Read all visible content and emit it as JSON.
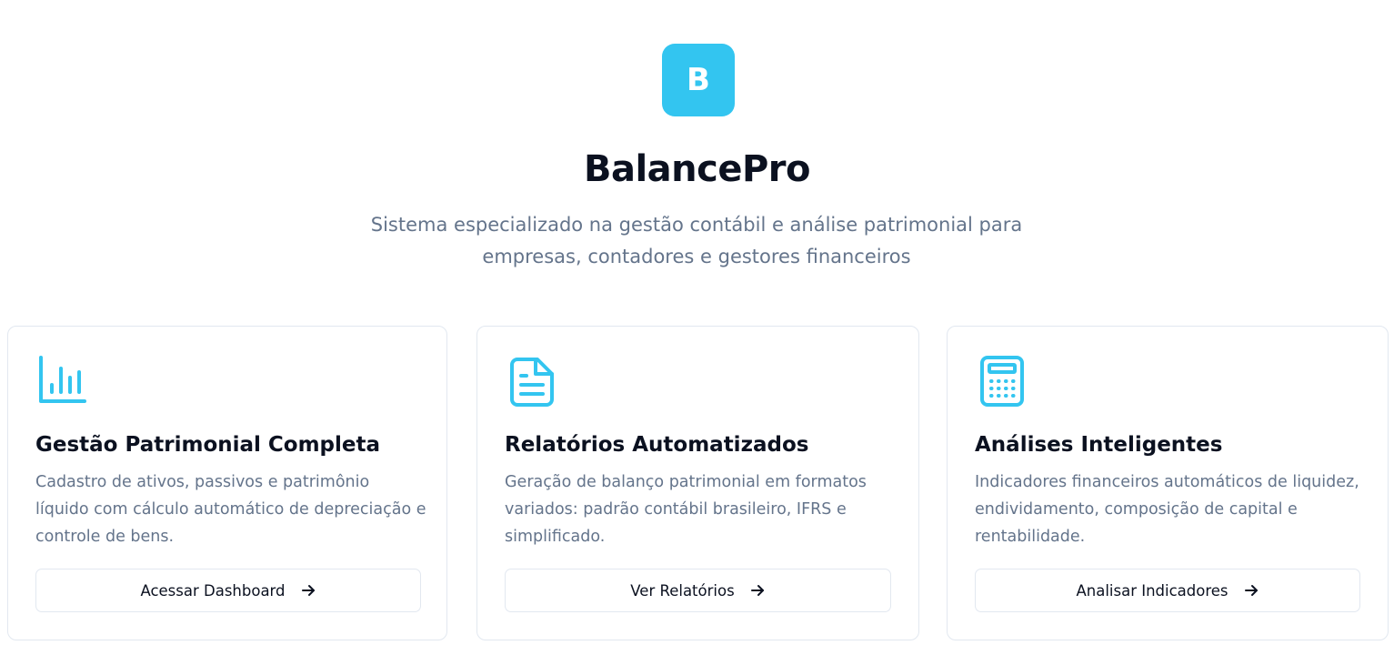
{
  "brand": {
    "logo_letter": "B",
    "name": "BalancePro",
    "tagline": "Sistema especializado na gestão contábil e análise patrimonial para empresas, contadores e gestores financeiros",
    "accent_color": "#33c5f0"
  },
  "cards": [
    {
      "icon": "bar-chart-icon",
      "title": "Gestão Patrimonial Completa",
      "description": "Cadastro de ativos, passivos e patrimônio líquido com cálculo automático de depreciação e controle de bens.",
      "button_label": "Acessar Dashboard"
    },
    {
      "icon": "document-icon",
      "title": "Relatórios Automatizados",
      "description": "Geração de balanço patrimonial em formatos variados: padrão contábil brasileiro, IFRS e simplificado.",
      "button_label": "Ver Relatórios"
    },
    {
      "icon": "calculator-icon",
      "title": "Análises Inteligentes",
      "description": "Indicadores financeiros automáticos de liquidez, endividamento, composição de capital e rentabilidade.",
      "button_label": "Analisar Indicadores"
    }
  ]
}
